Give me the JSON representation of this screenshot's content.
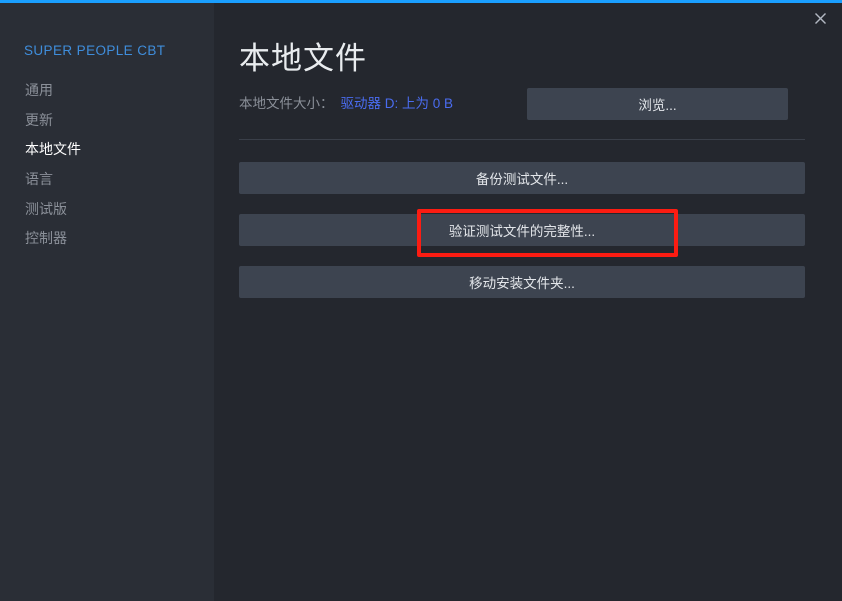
{
  "window": {
    "close_label": "×",
    "accent_color": "#1a9fff"
  },
  "sidebar": {
    "app_title": "SUPER PEOPLE CBT",
    "items": [
      {
        "label": "通用",
        "active": false
      },
      {
        "label": "更新",
        "active": false
      },
      {
        "label": "本地文件",
        "active": true
      },
      {
        "label": "语言",
        "active": false
      },
      {
        "label": "测试版",
        "active": false
      },
      {
        "label": "控制器",
        "active": false
      }
    ]
  },
  "main": {
    "page_title": "本地文件",
    "size_row": {
      "label": "本地文件大小：",
      "link": "驱动器 D: 上为 0 B",
      "link_color": "#4a6cf0"
    },
    "browse_button": "浏览...",
    "buttons": [
      {
        "label": "备份测试文件..."
      },
      {
        "label": "验证测试文件的完整性..."
      },
      {
        "label": "移动安装文件夹..."
      }
    ]
  },
  "annotation": {
    "highlight_color": "#fc1c12",
    "highlight_target": "验证测试文件的完整性..."
  }
}
